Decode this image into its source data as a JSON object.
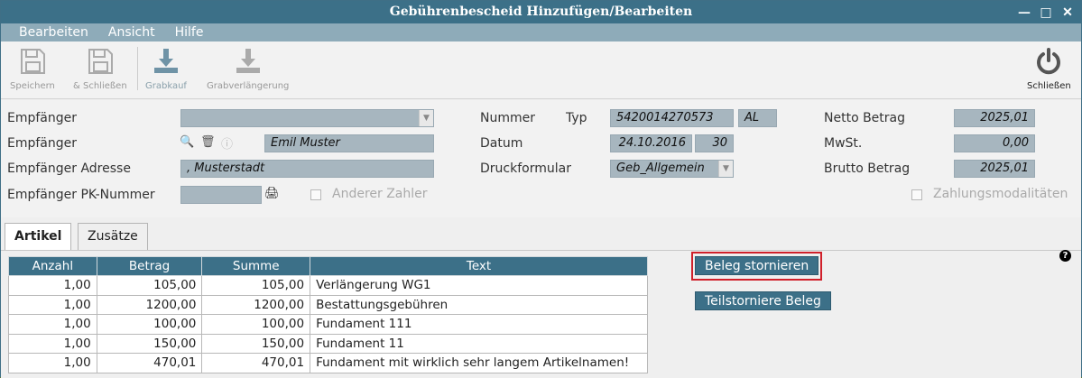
{
  "window": {
    "title": "Gebührenbescheid Hinzufügen/Bearbeiten",
    "controls": [
      "close-icon",
      "maximize-icon",
      "minimize-icon"
    ]
  },
  "menu": {
    "items": [
      "Bearbeiten",
      "Ansicht",
      "Hilfe"
    ]
  },
  "toolbar": {
    "save": "Speichern",
    "save_close": "& Schließen",
    "grabkauf": "Grabkauf",
    "grabverlaengerung": "Grabverlängerung",
    "close": "Schließen"
  },
  "form": {
    "empfaenger_label_1": "Empfänger",
    "empfaenger_label_2": "Empfänger",
    "empfaenger_value": "Emil Muster",
    "adresse_label": "Empfänger Adresse",
    "adresse_value": ", Musterstadt",
    "pk_label": "Empfänger PK-Nummer",
    "anderer_zahler": "Anderer Zahler",
    "nummer_label": "Nummer",
    "typ_label": "Typ",
    "nummer_value": "5420014270573",
    "typ_value": "AL",
    "datum_label": "Datum",
    "datum_value": "24.10.2016",
    "datum_days": "30",
    "druckformular_label": "Druckformular",
    "druckformular_value": "Geb_Allgemein",
    "netto_label": "Netto Betrag",
    "netto_value": "2025,01",
    "mwst_label": "MwSt.",
    "mwst_value": "0,00",
    "brutto_label": "Brutto Betrag",
    "brutto_value": "2025,01",
    "zahlungsmodalitaeten": "Zahlungsmodalitäten"
  },
  "tabs": [
    "Artikel",
    "Zusätze"
  ],
  "table": {
    "headers": [
      "Anzahl",
      "Betrag",
      "Summe",
      "Text"
    ],
    "rows": [
      [
        "1,00",
        "105,00",
        "105,00",
        "Verlängerung WG1"
      ],
      [
        "1,00",
        "1200,00",
        "1200,00",
        "Bestattungsgebühren"
      ],
      [
        "1,00",
        "100,00",
        "100,00",
        "Fundament 111"
      ],
      [
        "1,00",
        "150,00",
        "150,00",
        "Fundament 11"
      ],
      [
        "1,00",
        "470,01",
        "470,01",
        "Fundament mit wirklich sehr langem Artikelnamen!"
      ]
    ]
  },
  "actions": {
    "storno": "Beleg stornieren",
    "teilstorno": "Teilstorniere Beleg",
    "help": "?"
  },
  "colors": {
    "titlebar": "#3c7088",
    "menubar": "#8eabb9",
    "field": "#a7b6bf",
    "highlight": "#d0202a"
  }
}
